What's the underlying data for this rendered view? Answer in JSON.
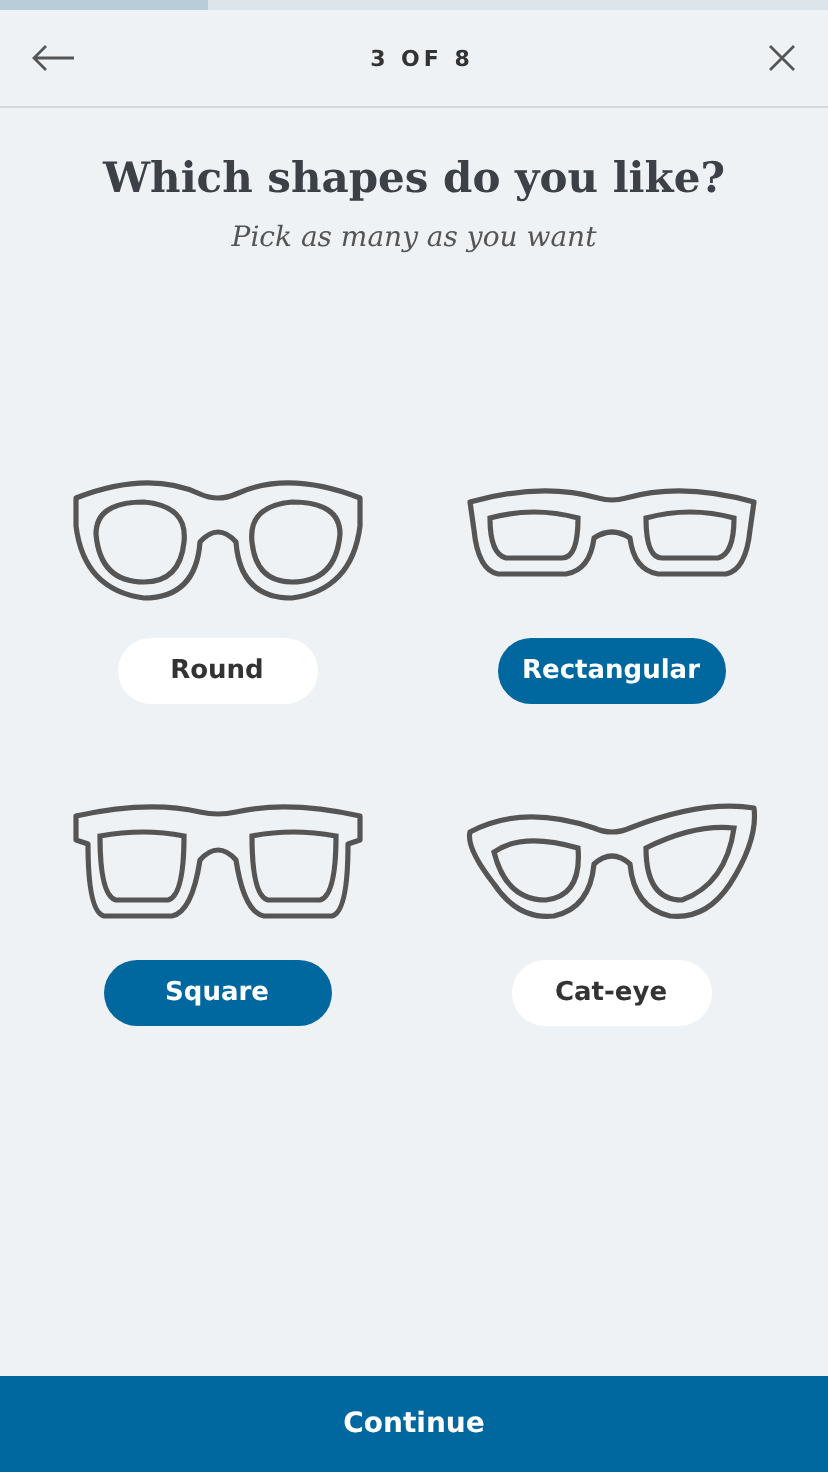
{
  "progress": {
    "level": 0.25
  },
  "header": {
    "step": "3 OF 8"
  },
  "title": "Which shapes do you like?",
  "subtitle": "Pick as many as you want",
  "shapes": [
    {
      "kind": "round",
      "label": "Round",
      "selected": false
    },
    {
      "kind": "rectangular",
      "label": "Rectangular",
      "selected": true
    },
    {
      "kind": "square",
      "label": "Square",
      "selected": true
    },
    {
      "kind": "cat-eye",
      "label": "Cat-eye",
      "selected": false
    }
  ],
  "continue_button": "Continue"
}
